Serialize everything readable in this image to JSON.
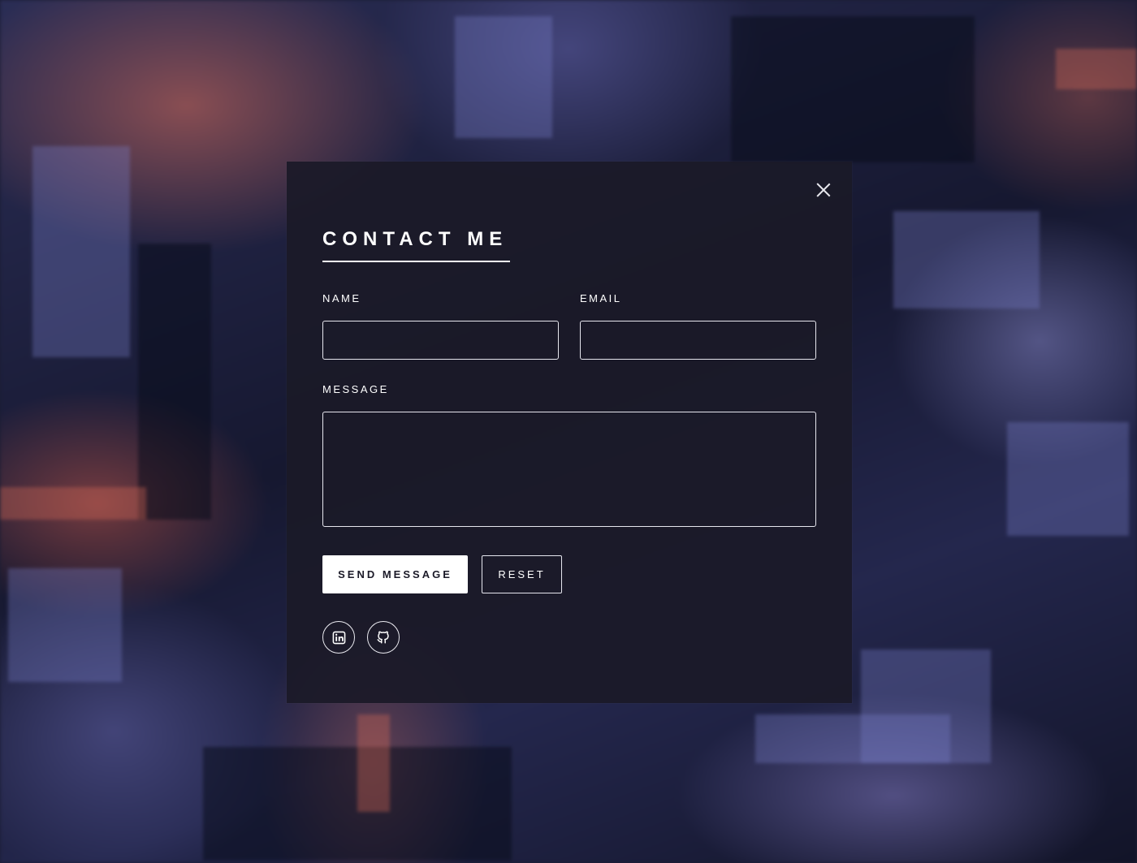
{
  "modal": {
    "title": "CONTACT ME",
    "close_icon": "close-icon"
  },
  "form": {
    "name": {
      "label": "NAME",
      "value": ""
    },
    "email": {
      "label": "EMAIL",
      "value": ""
    },
    "message": {
      "label": "MESSAGE",
      "value": ""
    }
  },
  "buttons": {
    "send_label": "SEND MESSAGE",
    "reset_label": "RESET"
  },
  "social": [
    {
      "icon": "linkedin-icon"
    },
    {
      "icon": "github-icon"
    }
  ],
  "colors": {
    "accent": "#ffffff",
    "panel": "#1b1a28"
  }
}
